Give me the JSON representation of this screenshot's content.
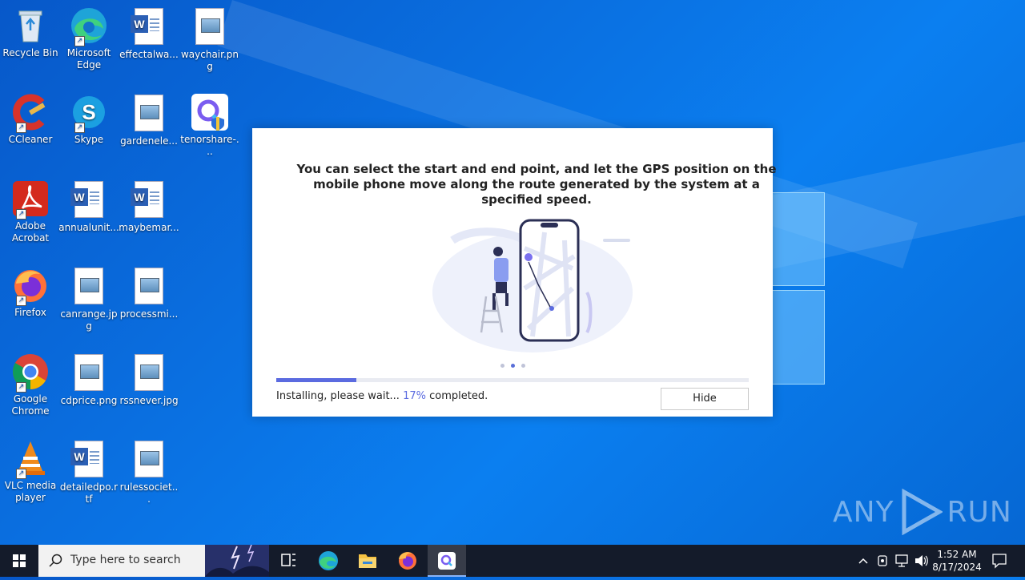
{
  "desktop": {
    "icons": [
      {
        "label": "Recycle Bin",
        "icon": "recycle-bin-icon"
      },
      {
        "label": "Microsoft Edge",
        "icon": "edge-icon"
      },
      {
        "label": "effectalwa...",
        "icon": "word-document-icon"
      },
      {
        "label": "waychair.png",
        "icon": "image-file-icon"
      },
      {
        "label": "CCleaner",
        "icon": "ccleaner-icon"
      },
      {
        "label": "Skype",
        "icon": "skype-icon"
      },
      {
        "label": "gardenele...",
        "icon": "image-file-icon"
      },
      {
        "label": "tenorshare-...",
        "icon": "tenorshare-icon"
      },
      {
        "label": "Adobe Acrobat",
        "icon": "acrobat-icon"
      },
      {
        "label": "annualunit...",
        "icon": "word-document-icon"
      },
      {
        "label": "maybemar...",
        "icon": "word-document-icon"
      },
      {
        "label": "Firefox",
        "icon": "firefox-icon"
      },
      {
        "label": "canrange.jpg",
        "icon": "image-file-icon"
      },
      {
        "label": "processmi...",
        "icon": "image-file-icon"
      },
      {
        "label": "Google Chrome",
        "icon": "chrome-icon"
      },
      {
        "label": "cdprice.png",
        "icon": "image-file-icon"
      },
      {
        "label": "rssnever.jpg",
        "icon": "image-file-icon"
      },
      {
        "label": "VLC media player",
        "icon": "vlc-icon"
      },
      {
        "label": "detailedpo.rtf",
        "icon": "word-document-icon"
      },
      {
        "label": "rulessociet...",
        "icon": "image-file-icon"
      }
    ]
  },
  "dialog": {
    "message": "You can select the start and end point, and let the GPS position on the mobile phone move along the route generated by the system at a specified speed.",
    "status_prefix": "Installing, please wait...",
    "percent": "17%",
    "status_suffix": "completed.",
    "progress": 0.17,
    "hide_label": "Hide",
    "carousel_active_index": 1
  },
  "watermark": {
    "left": "ANY",
    "right": "RUN"
  },
  "taskbar": {
    "search_placeholder": "Type here to search",
    "pinned": [
      "task-view-icon",
      "edge-icon",
      "file-explorer-icon",
      "firefox-icon",
      "tenorshare-icon"
    ],
    "clock_time": "1:52 AM",
    "clock_date": "8/17/2024"
  },
  "colors": {
    "accent": "#5b6be0",
    "desktop": "#0a6fe0",
    "taskbar": "#141b2a"
  }
}
